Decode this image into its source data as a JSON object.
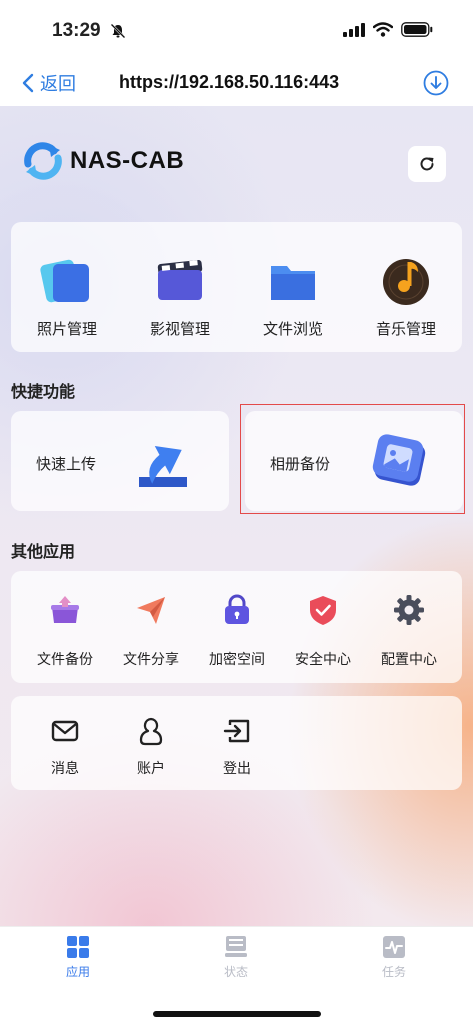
{
  "status_bar": {
    "time": "13:29"
  },
  "url_bar": {
    "back_label": "返回",
    "url": "https://192.168.50.116:443"
  },
  "brand": {
    "name": "NAS-CAB"
  },
  "top_menu": [
    {
      "label": "照片管理",
      "icon": "photo-icon"
    },
    {
      "label": "影视管理",
      "icon": "video-icon"
    },
    {
      "label": "文件浏览",
      "icon": "folder-icon"
    },
    {
      "label": "音乐管理",
      "icon": "music-icon"
    }
  ],
  "quick_section": {
    "title": "快捷功能",
    "items": [
      {
        "label": "快速上传",
        "icon": "upload-arrow-icon"
      },
      {
        "label": "相册备份",
        "icon": "album-icon"
      }
    ]
  },
  "other_section": {
    "title": "其他应用",
    "items": [
      {
        "label": "文件备份",
        "icon": "box-backup-icon"
      },
      {
        "label": "文件分享",
        "icon": "paper-plane-icon"
      },
      {
        "label": "加密空间",
        "icon": "lock-icon"
      },
      {
        "label": "安全中心",
        "icon": "shield-icon"
      },
      {
        "label": "配置中心",
        "icon": "gear-icon"
      }
    ]
  },
  "misc": [
    {
      "label": "消息",
      "icon": "envelope-icon"
    },
    {
      "label": "账户",
      "icon": "user-icon"
    },
    {
      "label": "登出",
      "icon": "logout-icon"
    }
  ],
  "tabbar": [
    {
      "label": "应用",
      "icon": "grid-icon",
      "active": true
    },
    {
      "label": "状态",
      "icon": "server-icon",
      "active": false
    },
    {
      "label": "任务",
      "icon": "activity-icon",
      "active": false
    }
  ],
  "colors": {
    "accent": "#2f7de1",
    "tab_active": "#3a7bea",
    "tab_inactive": "#b9bcc6",
    "highlight_border": "#e34a4a"
  }
}
